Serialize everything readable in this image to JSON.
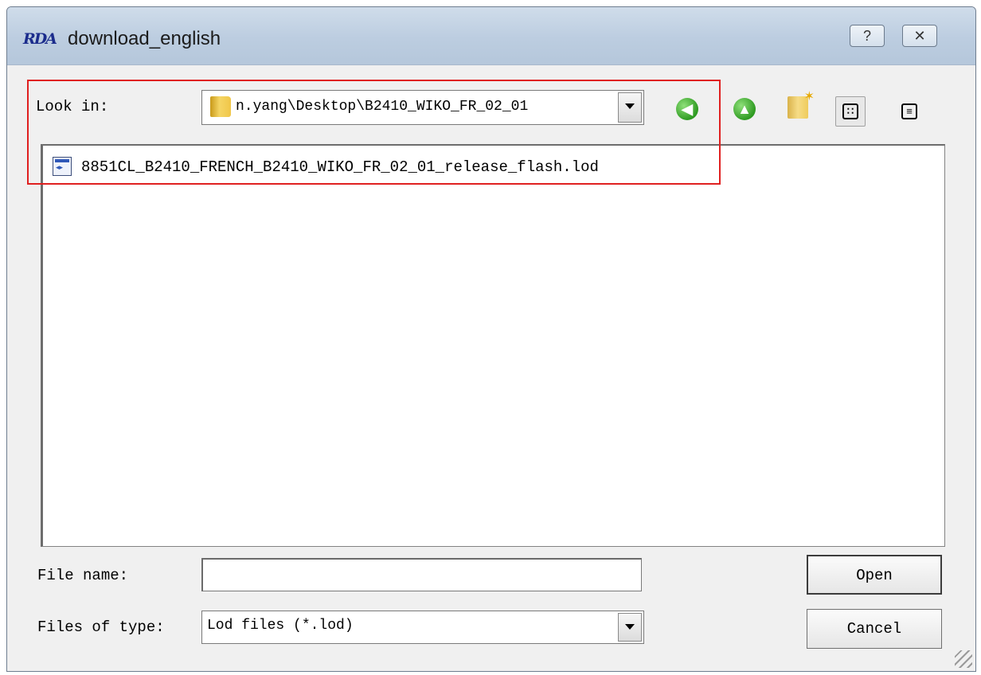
{
  "window": {
    "title": "download_english",
    "logo_text": "RDA",
    "help_glyph": "?",
    "close_glyph": "✕"
  },
  "look_in": {
    "label": "Look in:",
    "path": "n.yang\\Desktop\\B2410_WIKO_FR_02_01"
  },
  "toolbar": {
    "back_icon": "back-arrow-icon",
    "up_icon": "up-arrow-icon",
    "new_folder_icon": "new-folder-icon",
    "list_view_icon": "list-view-icon",
    "details_view_icon": "details-view-icon",
    "back_glyph": "◀",
    "up_glyph": "▲",
    "list_glyph": "∷",
    "details_glyph": "≡"
  },
  "files": [
    {
      "name": "8851CL_B2410_FRENCH_B2410_WIKO_FR_02_01_release_flash.lod"
    }
  ],
  "file_name": {
    "label": "File name:",
    "value": ""
  },
  "file_type": {
    "label": "Files of type:",
    "selected": "Lod files (*.lod)"
  },
  "buttons": {
    "open": "Open",
    "cancel": "Cancel"
  },
  "colors": {
    "highlight": "#e02020",
    "accent_green": "#2f9b22"
  }
}
